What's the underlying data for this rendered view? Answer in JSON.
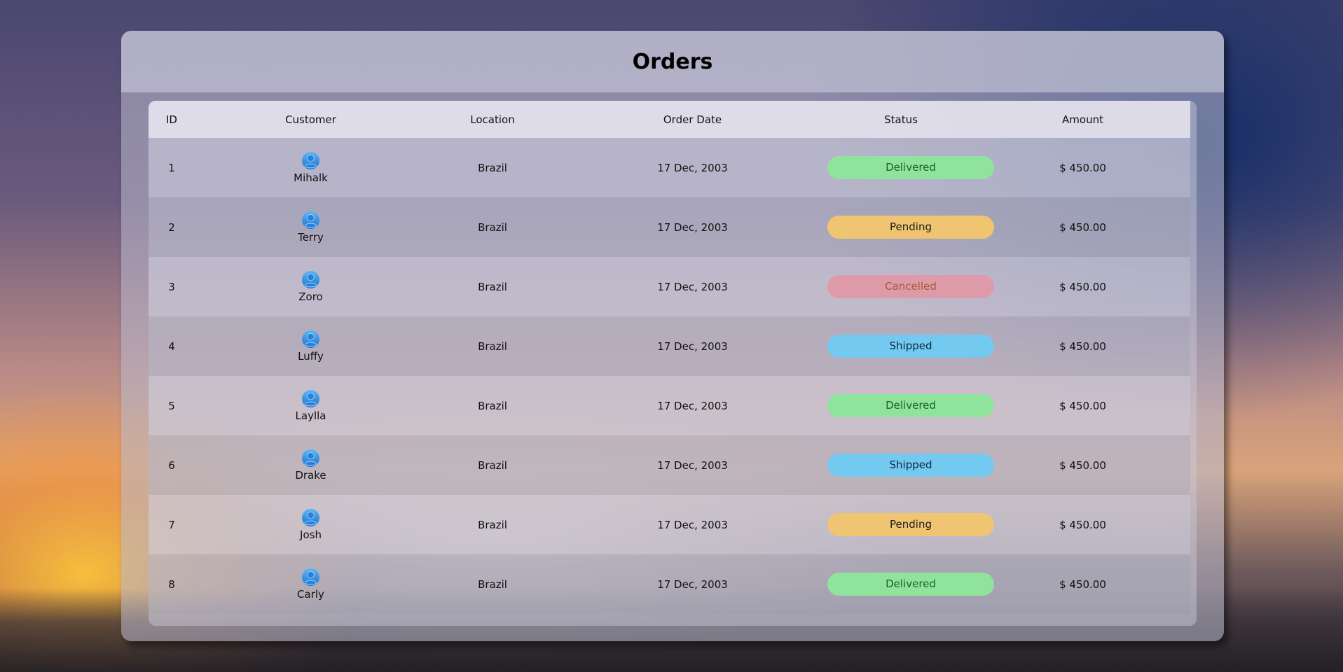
{
  "page": {
    "title": "Orders"
  },
  "table": {
    "columns": [
      "ID",
      "Customer",
      "Location",
      "Order Date",
      "Status",
      "Amount"
    ],
    "rows": [
      {
        "id": "1",
        "customer": "Mihalk",
        "location": "Brazil",
        "date": "17 Dec, 2003",
        "status": "Delivered",
        "amount": "$ 450.00"
      },
      {
        "id": "2",
        "customer": "Terry",
        "location": "Brazil",
        "date": "17 Dec, 2003",
        "status": "Pending",
        "amount": "$ 450.00"
      },
      {
        "id": "3",
        "customer": "Zoro",
        "location": "Brazil",
        "date": "17 Dec, 2003",
        "status": "Cancelled",
        "amount": "$ 450.00"
      },
      {
        "id": "4",
        "customer": "Luffy",
        "location": "Brazil",
        "date": "17 Dec, 2003",
        "status": "Shipped",
        "amount": "$ 450.00"
      },
      {
        "id": "5",
        "customer": "Laylla",
        "location": "Brazil",
        "date": "17 Dec, 2003",
        "status": "Delivered",
        "amount": "$ 450.00"
      },
      {
        "id": "6",
        "customer": "Drake",
        "location": "Brazil",
        "date": "17 Dec, 2003",
        "status": "Shipped",
        "amount": "$ 450.00"
      },
      {
        "id": "7",
        "customer": "Josh",
        "location": "Brazil",
        "date": "17 Dec, 2003",
        "status": "Pending",
        "amount": "$ 450.00"
      },
      {
        "id": "8",
        "customer": "Carly",
        "location": "Brazil",
        "date": "17 Dec, 2003",
        "status": "Delivered",
        "amount": "$ 450.00"
      }
    ]
  },
  "status_colors": {
    "Delivered": {
      "bg": "#8fe39c",
      "fg": "#17642a"
    },
    "Pending": {
      "bg": "#efc572",
      "fg": "#1b1b1b"
    },
    "Cancelled": {
      "bg": "#de9aa8",
      "fg": "#a35e3a"
    },
    "Shipped": {
      "bg": "#74c9f0",
      "fg": "#0e2640"
    }
  },
  "icons": {
    "avatar": "user-avatar-icon"
  }
}
